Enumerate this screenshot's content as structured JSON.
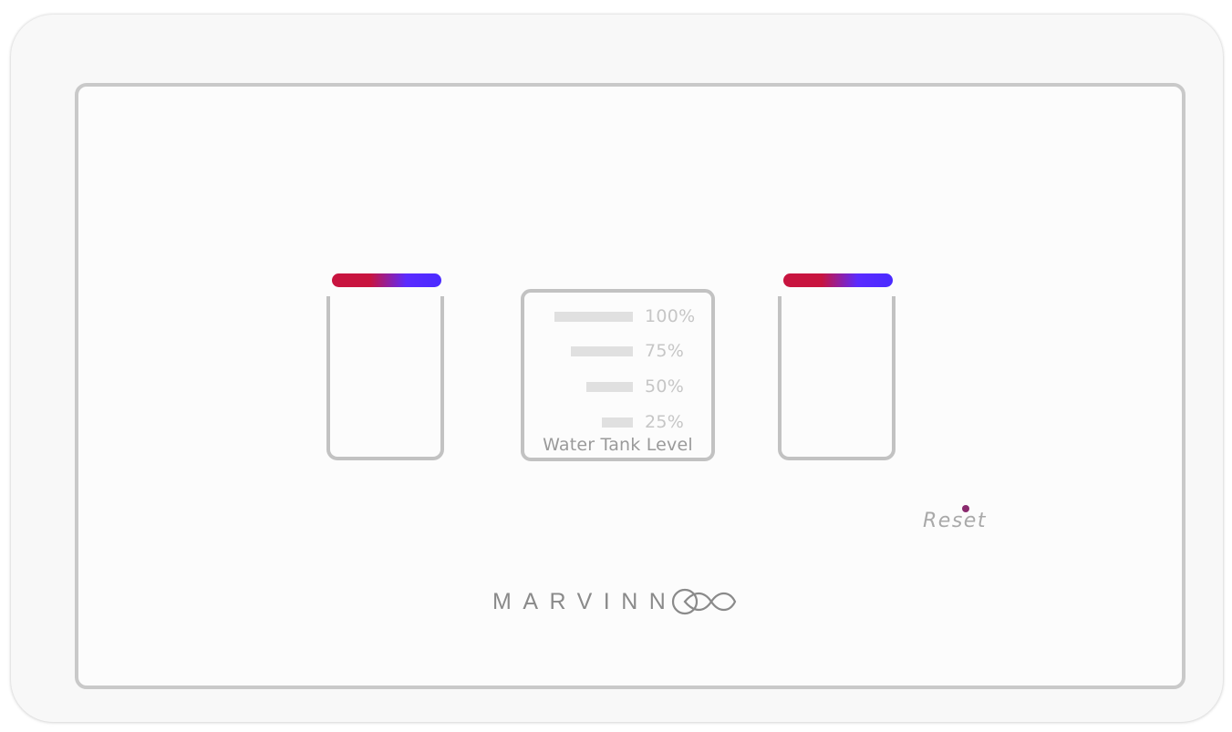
{
  "device": {
    "switches": [
      {
        "id": "left",
        "led_colors": [
          "#c8143f",
          "#4a2bff"
        ]
      },
      {
        "id": "right",
        "led_colors": [
          "#c8143f",
          "#4a2bff"
        ]
      }
    ],
    "water_tank": {
      "levels": [
        {
          "label": "100%",
          "value": 100
        },
        {
          "label": "75%",
          "value": 75
        },
        {
          "label": "50%",
          "value": 50
        },
        {
          "label": "25%",
          "value": 25
        }
      ],
      "title": "Water Tank Level"
    },
    "reset": {
      "label": "Reset",
      "indicator_color": "#8a2a6e"
    },
    "brand": {
      "name": "MARVINN",
      "logo_icon": "infinity-loop-icon"
    }
  }
}
